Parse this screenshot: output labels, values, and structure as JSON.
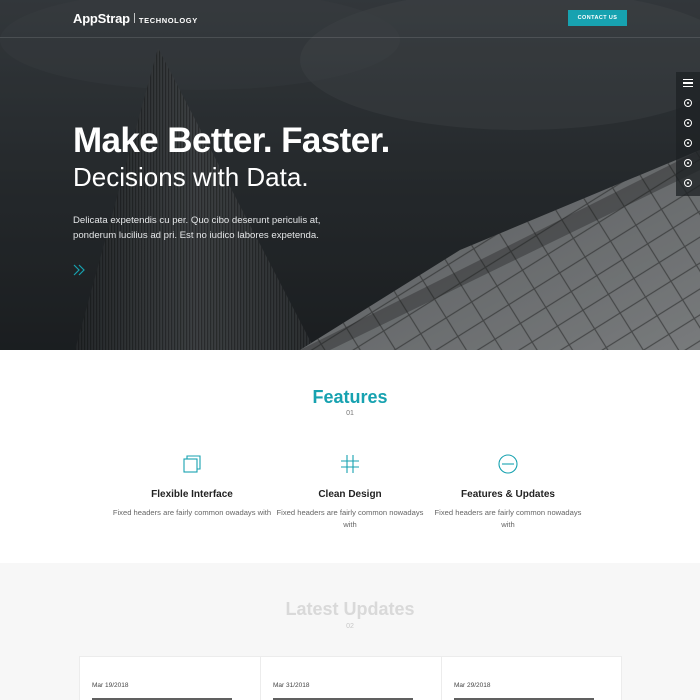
{
  "header": {
    "brand_name": "AppStrap",
    "brand_sub": "TECHNOLOGY",
    "cta_label": "CONTACT US"
  },
  "hero": {
    "title": "Make Better. Faster.",
    "subtitle": "Decisions with Data.",
    "description": "Delicata expetendis cu per. Quo cibo deserunt periculis at, ponderum lucilius ad pri. Est no iudico labores expetenda."
  },
  "side_nav": {
    "items": [
      "menu-icon",
      "dot-1",
      "dot-2",
      "dot-3",
      "dot-4",
      "dot-5"
    ]
  },
  "features": {
    "title": "Features",
    "number": "01",
    "items": [
      {
        "icon": "layers-icon",
        "title": "Flexible Interface",
        "desc": "Fixed headers are fairly common owadays with"
      },
      {
        "icon": "grid-icon",
        "title": "Clean Design",
        "desc": "Fixed headers are fairly common nowadays with"
      },
      {
        "icon": "circle-minus-icon",
        "title": "Features & Updates",
        "desc": "Fixed headers are fairly common nowadays with"
      }
    ]
  },
  "updates": {
    "title": "Latest Updates",
    "number": "02",
    "cards": [
      {
        "date": "Mar 19/2018"
      },
      {
        "date": "Mar 31/2018"
      },
      {
        "date": "Mar 29/2018"
      }
    ]
  },
  "colors": {
    "accent": "#17a2b0",
    "hero_dark": "#2c3034",
    "muted_title": "#d9d9d9"
  }
}
